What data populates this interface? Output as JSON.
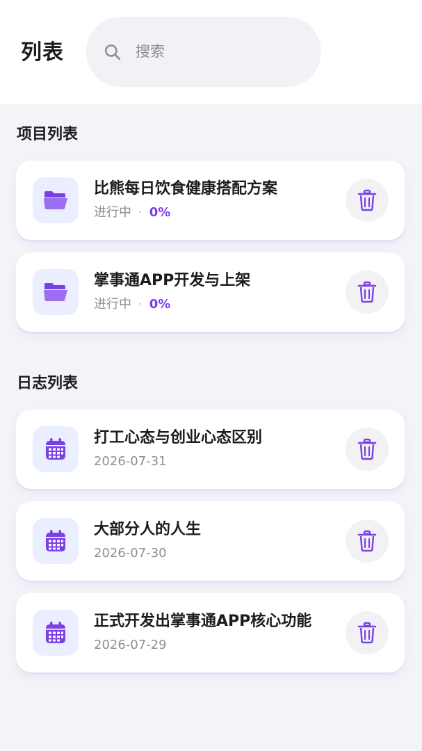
{
  "header": {
    "title": "列表",
    "search": {
      "placeholder": "搜索"
    }
  },
  "projects": {
    "section_title": "项目列表",
    "items": [
      {
        "title": "比熊每日饮食健康搭配方案",
        "status": "进行中",
        "separator": "·",
        "progress": "0%"
      },
      {
        "title": "掌事通APP开发与上架",
        "status": "进行中",
        "separator": "·",
        "progress": "0%"
      }
    ]
  },
  "logs": {
    "section_title": "日志列表",
    "items": [
      {
        "title": "打工心态与创业心态区别",
        "date": "2026-07-31"
      },
      {
        "title": "大部分人的人生",
        "date": "2026-07-30"
      },
      {
        "title": "正式开发出掌事通APP核心功能",
        "date": "2026-07-29"
      }
    ]
  },
  "colors": {
    "accent": "#7b3fe4",
    "icon_bg": "#ebeefe",
    "page_bg": "#f3f4f8"
  },
  "icons": {
    "search": "search-icon",
    "project": "folder-icon",
    "log": "calendar-icon",
    "delete": "trash-icon"
  }
}
